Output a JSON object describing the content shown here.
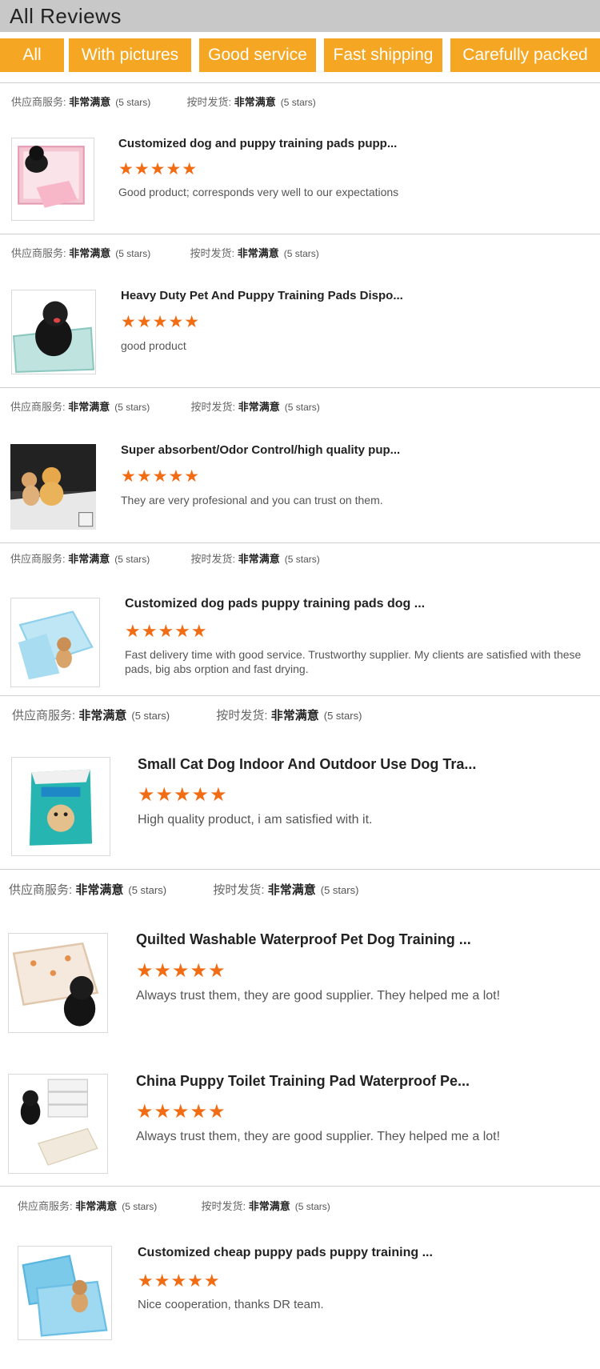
{
  "header": {
    "title": "All Reviews"
  },
  "filters": [
    {
      "label": "All"
    },
    {
      "label": "With pictures"
    },
    {
      "label": "Good service"
    },
    {
      "label": "Fast shipping"
    },
    {
      "label": "Carefully packed"
    }
  ],
  "meta_labels": {
    "supplier_service": "供应商服务:",
    "on_time_delivery": "按时发货:",
    "very_satisfied": "非常满意",
    "stars_text": "(5 stars)"
  },
  "accent_color": "#f5a623",
  "star_color": "#f26c14",
  "reviews": [
    {
      "title": "Customized dog and puppy training pads pupp...",
      "rating": 5,
      "stars": "★★★★★",
      "comment": "Good product; corresponds very well to our expectations",
      "image_icon": "pink-pads-with-black-dog"
    },
    {
      "title": "Heavy Duty Pet And Puppy Training Pads Dispo...",
      "rating": 5,
      "stars": "★★★★★",
      "comment": "good product",
      "image_icon": "black-dog-on-pad"
    },
    {
      "title": "Super absorbent/Odor Control/high quality pup...",
      "rating": 5,
      "stars": "★★★★★",
      "comment": "They are very profesional and you can trust on them.",
      "image_icon": "cat-and-dog-on-pads"
    },
    {
      "title": "Customized dog pads puppy training pads dog ...",
      "rating": 5,
      "stars": "★★★★★",
      "comment": "Fast delivery time with good service. Trustworthy supplier. My clients are satisfied with these pads, big abs  orption and fast drying.",
      "image_icon": "blue-pads-with-puppy"
    },
    {
      "title": "Small Cat Dog Indoor And Outdoor Use Dog Tra...",
      "rating": 5,
      "stars": "★★★★★",
      "comment": "High quality product, i am satisfied with it.",
      "image_icon": "pad-package"
    },
    {
      "title": "Quilted Washable Waterproof Pet Dog Training ...",
      "rating": 5,
      "stars": "★★★★★",
      "comment": "Always trust them, they are good supplier. They helped me a lot!",
      "image_icon": "quilted-pad-black-dog"
    },
    {
      "title": "China Puppy Toilet Training Pad Waterproof Pe...",
      "rating": 5,
      "stars": "★★★★★",
      "comment": "Always trust them, they are good supplier. They helped me a lot!",
      "image_icon": "white-pads-black-dog"
    },
    {
      "title": "Customized cheap puppy pads puppy training ...",
      "rating": 5,
      "stars": "★★★★★",
      "comment": "Nice cooperation, thanks DR team.",
      "image_icon": "blue-pads-small-dog"
    }
  ]
}
